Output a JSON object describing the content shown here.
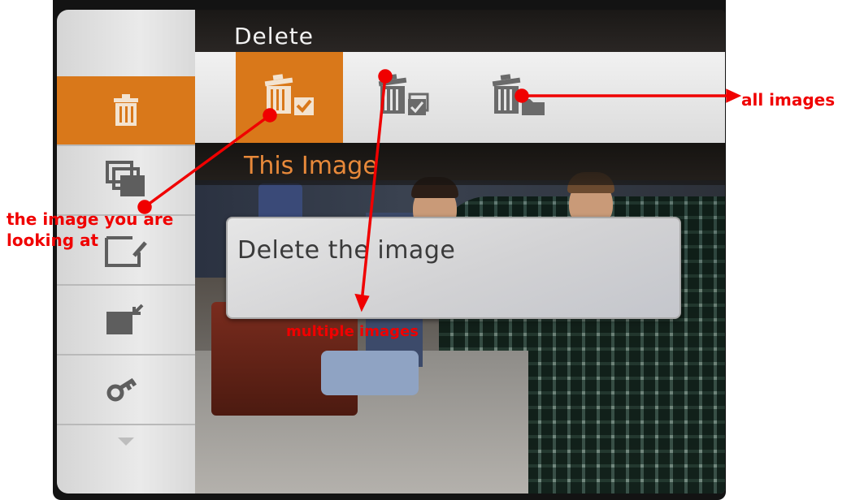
{
  "screen": {
    "menu_title": "Delete",
    "subtitle": "This Image",
    "dialog_text": "Delete the image",
    "sidebar_items": [
      {
        "icon": "trash-icon",
        "active": true
      },
      {
        "icon": "copy-images-icon",
        "active": false
      },
      {
        "icon": "edit-frame-icon",
        "active": false
      },
      {
        "icon": "import-image-icon",
        "active": false
      },
      {
        "icon": "key-icon",
        "active": false
      },
      {
        "icon": "more-arrow-icon",
        "active": false
      }
    ],
    "delete_options": [
      {
        "icon": "delete-this-image-icon",
        "selected": true
      },
      {
        "icon": "delete-multiple-images-icon",
        "selected": false
      },
      {
        "icon": "delete-all-images-icon",
        "selected": false
      }
    ]
  },
  "annotations": {
    "this_image": [
      "the image you are",
      "looking at"
    ],
    "multiple_images": "multiple images",
    "all_images": "all images"
  },
  "colors": {
    "accent_orange": "#d9781a",
    "annotation_red": "#f00000",
    "subtitle_orange": "#e8893a"
  }
}
